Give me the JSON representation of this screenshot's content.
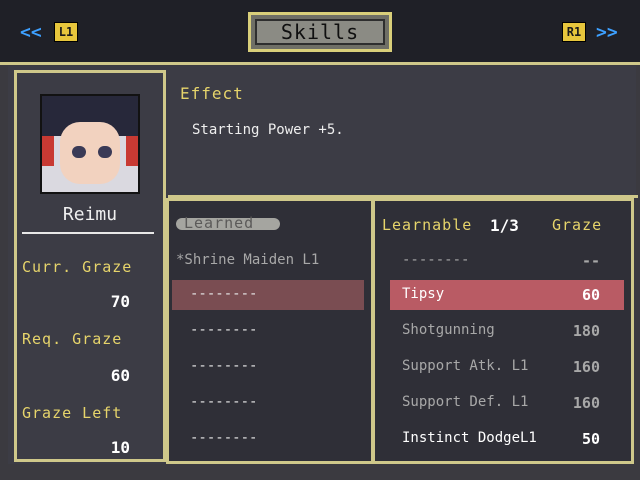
{
  "header": {
    "title": "Skills",
    "left_arrow": "<<",
    "right_arrow": ">>",
    "left_button": "L1",
    "right_button": "R1"
  },
  "character": {
    "name": "Reimu",
    "stats": [
      {
        "label": "Curr. Graze",
        "value": "70"
      },
      {
        "label": "Req. Graze",
        "value": "60"
      },
      {
        "label": "Graze Left",
        "value": "10"
      }
    ]
  },
  "effect": {
    "label": "Effect",
    "text": "Starting Power +5."
  },
  "learned": {
    "label": "Learned",
    "items": [
      "*Shrine Maiden L1",
      "--------",
      "--------",
      "--------",
      "--------",
      "--------"
    ]
  },
  "learnable": {
    "label": "Learnable",
    "count": "1/3",
    "cost_label": "Graze",
    "items": [
      {
        "name": "--------",
        "cost": "--"
      },
      {
        "name": "Tipsy",
        "cost": "60"
      },
      {
        "name": "Shotgunning",
        "cost": "180"
      },
      {
        "name": "Support Atk. L1",
        "cost": "160"
      },
      {
        "name": "Support Def. L1",
        "cost": "160"
      },
      {
        "name": "Instinct DodgeL1",
        "cost": "50"
      }
    ]
  },
  "colors": {
    "frame": "#cfc88a",
    "accent_yellow": "#e6d46b",
    "highlight": "#b95b64"
  }
}
